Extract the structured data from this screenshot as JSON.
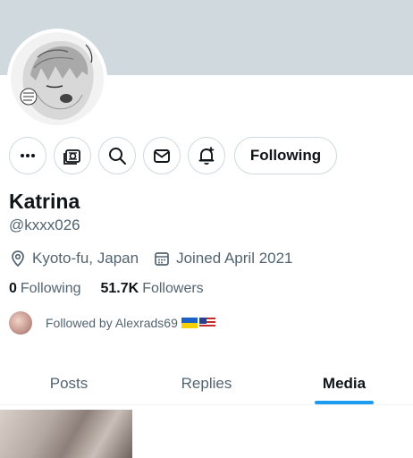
{
  "profile": {
    "name": "Katrina",
    "handle": "@kxxx026",
    "location": "Kyoto-fu, Japan",
    "joined": "Joined April 2021",
    "following_count": "0",
    "following_label": "Following",
    "followers_count": "51.7K",
    "followers_label": "Followers",
    "followed_by": "Followed by Alexrads69"
  },
  "actions": {
    "follow_label": "Following",
    "icons": [
      "more-icon",
      "subscriptions-icon",
      "search-icon",
      "message-icon",
      "notification-bell-icon"
    ]
  },
  "tabs": [
    {
      "label": "Posts",
      "active": false
    },
    {
      "label": "Replies",
      "active": false
    },
    {
      "label": "Media",
      "active": true
    }
  ],
  "colors": {
    "accent": "#1d9bf0",
    "banner": "#cfd9de",
    "text_primary": "#0f1419",
    "text_secondary": "#536471",
    "border": "#cfd9de"
  }
}
